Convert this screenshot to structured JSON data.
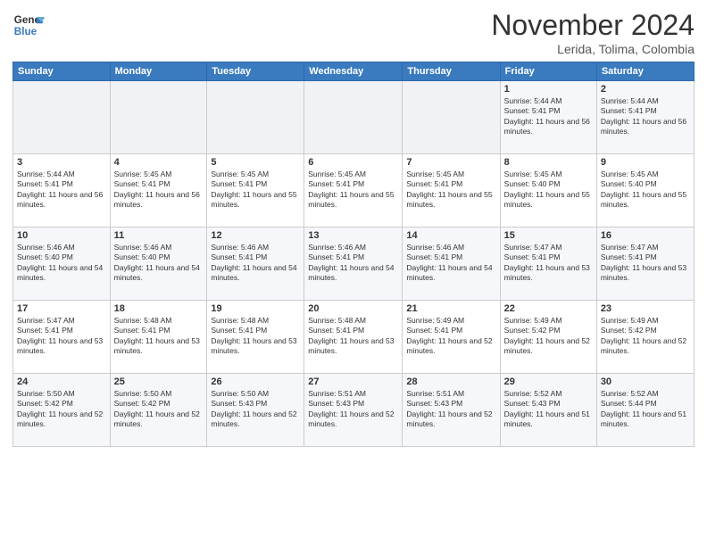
{
  "header": {
    "logo_line1": "General",
    "logo_line2": "Blue",
    "month_title": "November 2024",
    "subtitle": "Lerida, Tolima, Colombia"
  },
  "weekdays": [
    "Sunday",
    "Monday",
    "Tuesday",
    "Wednesday",
    "Thursday",
    "Friday",
    "Saturday"
  ],
  "weeks": [
    [
      {
        "day": "",
        "empty": true,
        "text": ""
      },
      {
        "day": "",
        "empty": true,
        "text": ""
      },
      {
        "day": "",
        "empty": true,
        "text": ""
      },
      {
        "day": "",
        "empty": true,
        "text": ""
      },
      {
        "day": "",
        "empty": true,
        "text": ""
      },
      {
        "day": "1",
        "empty": false,
        "text": "Sunrise: 5:44 AM\nSunset: 5:41 PM\nDaylight: 11 hours and 56 minutes."
      },
      {
        "day": "2",
        "empty": false,
        "text": "Sunrise: 5:44 AM\nSunset: 5:41 PM\nDaylight: 11 hours and 56 minutes."
      }
    ],
    [
      {
        "day": "3",
        "empty": false,
        "text": "Sunrise: 5:44 AM\nSunset: 5:41 PM\nDaylight: 11 hours and 56 minutes."
      },
      {
        "day": "4",
        "empty": false,
        "text": "Sunrise: 5:45 AM\nSunset: 5:41 PM\nDaylight: 11 hours and 56 minutes."
      },
      {
        "day": "5",
        "empty": false,
        "text": "Sunrise: 5:45 AM\nSunset: 5:41 PM\nDaylight: 11 hours and 55 minutes."
      },
      {
        "day": "6",
        "empty": false,
        "text": "Sunrise: 5:45 AM\nSunset: 5:41 PM\nDaylight: 11 hours and 55 minutes."
      },
      {
        "day": "7",
        "empty": false,
        "text": "Sunrise: 5:45 AM\nSunset: 5:41 PM\nDaylight: 11 hours and 55 minutes."
      },
      {
        "day": "8",
        "empty": false,
        "text": "Sunrise: 5:45 AM\nSunset: 5:40 PM\nDaylight: 11 hours and 55 minutes."
      },
      {
        "day": "9",
        "empty": false,
        "text": "Sunrise: 5:45 AM\nSunset: 5:40 PM\nDaylight: 11 hours and 55 minutes."
      }
    ],
    [
      {
        "day": "10",
        "empty": false,
        "text": "Sunrise: 5:46 AM\nSunset: 5:40 PM\nDaylight: 11 hours and 54 minutes."
      },
      {
        "day": "11",
        "empty": false,
        "text": "Sunrise: 5:46 AM\nSunset: 5:40 PM\nDaylight: 11 hours and 54 minutes."
      },
      {
        "day": "12",
        "empty": false,
        "text": "Sunrise: 5:46 AM\nSunset: 5:41 PM\nDaylight: 11 hours and 54 minutes."
      },
      {
        "day": "13",
        "empty": false,
        "text": "Sunrise: 5:46 AM\nSunset: 5:41 PM\nDaylight: 11 hours and 54 minutes."
      },
      {
        "day": "14",
        "empty": false,
        "text": "Sunrise: 5:46 AM\nSunset: 5:41 PM\nDaylight: 11 hours and 54 minutes."
      },
      {
        "day": "15",
        "empty": false,
        "text": "Sunrise: 5:47 AM\nSunset: 5:41 PM\nDaylight: 11 hours and 53 minutes."
      },
      {
        "day": "16",
        "empty": false,
        "text": "Sunrise: 5:47 AM\nSunset: 5:41 PM\nDaylight: 11 hours and 53 minutes."
      }
    ],
    [
      {
        "day": "17",
        "empty": false,
        "text": "Sunrise: 5:47 AM\nSunset: 5:41 PM\nDaylight: 11 hours and 53 minutes."
      },
      {
        "day": "18",
        "empty": false,
        "text": "Sunrise: 5:48 AM\nSunset: 5:41 PM\nDaylight: 11 hours and 53 minutes."
      },
      {
        "day": "19",
        "empty": false,
        "text": "Sunrise: 5:48 AM\nSunset: 5:41 PM\nDaylight: 11 hours and 53 minutes."
      },
      {
        "day": "20",
        "empty": false,
        "text": "Sunrise: 5:48 AM\nSunset: 5:41 PM\nDaylight: 11 hours and 53 minutes."
      },
      {
        "day": "21",
        "empty": false,
        "text": "Sunrise: 5:49 AM\nSunset: 5:41 PM\nDaylight: 11 hours and 52 minutes."
      },
      {
        "day": "22",
        "empty": false,
        "text": "Sunrise: 5:49 AM\nSunset: 5:42 PM\nDaylight: 11 hours and 52 minutes."
      },
      {
        "day": "23",
        "empty": false,
        "text": "Sunrise: 5:49 AM\nSunset: 5:42 PM\nDaylight: 11 hours and 52 minutes."
      }
    ],
    [
      {
        "day": "24",
        "empty": false,
        "text": "Sunrise: 5:50 AM\nSunset: 5:42 PM\nDaylight: 11 hours and 52 minutes."
      },
      {
        "day": "25",
        "empty": false,
        "text": "Sunrise: 5:50 AM\nSunset: 5:42 PM\nDaylight: 11 hours and 52 minutes."
      },
      {
        "day": "26",
        "empty": false,
        "text": "Sunrise: 5:50 AM\nSunset: 5:43 PM\nDaylight: 11 hours and 52 minutes."
      },
      {
        "day": "27",
        "empty": false,
        "text": "Sunrise: 5:51 AM\nSunset: 5:43 PM\nDaylight: 11 hours and 52 minutes."
      },
      {
        "day": "28",
        "empty": false,
        "text": "Sunrise: 5:51 AM\nSunset: 5:43 PM\nDaylight: 11 hours and 52 minutes."
      },
      {
        "day": "29",
        "empty": false,
        "text": "Sunrise: 5:52 AM\nSunset: 5:43 PM\nDaylight: 11 hours and 51 minutes."
      },
      {
        "day": "30",
        "empty": false,
        "text": "Sunrise: 5:52 AM\nSunset: 5:44 PM\nDaylight: 11 hours and 51 minutes."
      }
    ]
  ]
}
